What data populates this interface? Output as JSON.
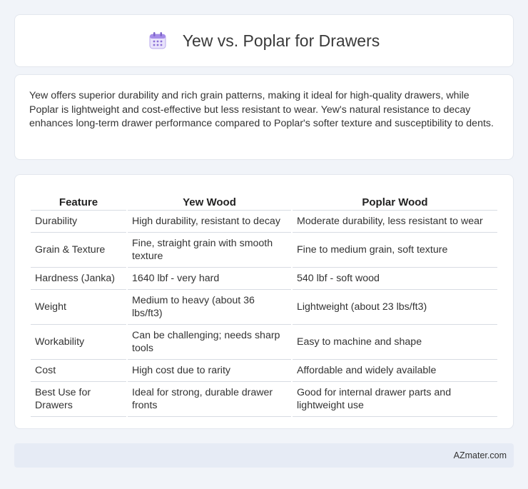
{
  "header": {
    "icon": "calendar-icon",
    "title": "Yew vs. Poplar for Drawers"
  },
  "summary": {
    "text": "Yew offers superior durability and rich grain patterns, making it ideal for high-quality drawers, while Poplar is lightweight and cost-effective but less resistant to wear. Yew's natural resistance to decay enhances long-term drawer performance compared to Poplar's softer texture and susceptibility to dents."
  },
  "table": {
    "headers": [
      "Feature",
      "Yew Wood",
      "Poplar Wood"
    ],
    "rows": [
      [
        "Durability",
        "High durability, resistant to decay",
        "Moderate durability, less resistant to wear"
      ],
      [
        "Grain & Texture",
        "Fine, straight grain with smooth texture",
        "Fine to medium grain, soft texture"
      ],
      [
        "Hardness (Janka)",
        "1640 lbf - very hard",
        "540 lbf - soft wood"
      ],
      [
        "Weight",
        "Medium to heavy (about 36 lbs/ft3)",
        "Lightweight (about 23 lbs/ft3)"
      ],
      [
        "Workability",
        "Can be challenging; needs sharp tools",
        "Easy to machine and shape"
      ],
      [
        "Cost",
        "High cost due to rarity",
        "Affordable and widely available"
      ],
      [
        "Best Use for Drawers",
        "Ideal for strong, durable drawer fronts",
        "Good for internal drawer parts and lightweight use"
      ]
    ]
  },
  "footer": {
    "brand": "AZmater.com"
  },
  "colors": {
    "background": "#f1f4f9",
    "card": "#ffffff",
    "footer": "#e6ebf5",
    "icon_accent": "#8a6fd6"
  }
}
